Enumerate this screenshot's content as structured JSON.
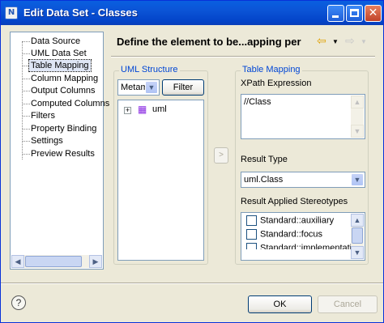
{
  "window": {
    "title": "Edit Data Set - Classes",
    "icon": "birt-icon",
    "controls": [
      "minimize",
      "maximize",
      "close"
    ]
  },
  "nav": {
    "items": [
      {
        "label": "Data Source"
      },
      {
        "label": "UML Data Set"
      },
      {
        "label": "Table Mapping",
        "selected": true
      },
      {
        "label": "Column Mapping"
      },
      {
        "label": "Output Columns"
      },
      {
        "label": "Computed Columns"
      },
      {
        "label": "Filters"
      },
      {
        "label": "Property Binding"
      },
      {
        "label": "Settings"
      },
      {
        "label": "Preview Results"
      }
    ]
  },
  "header": {
    "title": "Define the element to be...apping per",
    "back_icon": "back-arrow-icon",
    "forward_icon": "forward-arrow-icon"
  },
  "uml_structure": {
    "group_label": "UML Structure",
    "combo_value": "Metam",
    "filter_label": "Filter",
    "tree": [
      {
        "label": "uml",
        "icon": "package-icon",
        "expanded": false
      }
    ]
  },
  "move_button": ">",
  "table_mapping": {
    "group_label": "Table Mapping",
    "xpath_label": "XPath Expression",
    "xpath_value": "//Class",
    "result_type_label": "Result Type",
    "result_type_value": "uml.Class",
    "stereotypes_label": "Result Applied Stereotypes",
    "stereotypes": [
      {
        "label": "Standard::auxiliary",
        "checked": false
      },
      {
        "label": "Standard::focus",
        "checked": false
      },
      {
        "label": "Standard::implementati",
        "checked": false
      }
    ]
  },
  "footer": {
    "help_icon": "help-icon",
    "ok_label": "OK",
    "cancel_label": "Cancel"
  }
}
